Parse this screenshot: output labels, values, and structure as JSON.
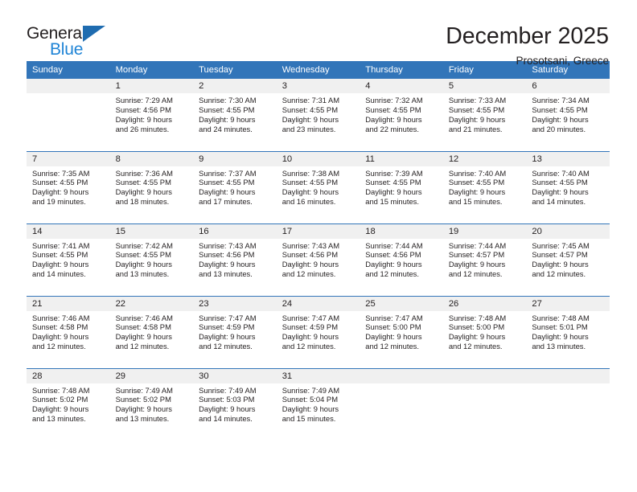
{
  "brand": {
    "name_dark": "General",
    "name_blue": "Blue",
    "accent_blue": "#1f84d6",
    "triangle_blue": "#1f6cb0"
  },
  "header": {
    "month_title": "December 2025",
    "location": "Prosotsani, Greece",
    "header_bg": "#3275b9",
    "daynum_bg": "#f0f0f0"
  },
  "weekday_headers": [
    "Sunday",
    "Monday",
    "Tuesday",
    "Wednesday",
    "Thursday",
    "Friday",
    "Saturday"
  ],
  "weeks": [
    [
      {
        "day": "",
        "sunrise": "",
        "sunset": "",
        "daylight_line1": "",
        "daylight_line2": ""
      },
      {
        "day": "1",
        "sunrise": "Sunrise: 7:29 AM",
        "sunset": "Sunset: 4:56 PM",
        "daylight_line1": "Daylight: 9 hours",
        "daylight_line2": "and 26 minutes."
      },
      {
        "day": "2",
        "sunrise": "Sunrise: 7:30 AM",
        "sunset": "Sunset: 4:55 PM",
        "daylight_line1": "Daylight: 9 hours",
        "daylight_line2": "and 24 minutes."
      },
      {
        "day": "3",
        "sunrise": "Sunrise: 7:31 AM",
        "sunset": "Sunset: 4:55 PM",
        "daylight_line1": "Daylight: 9 hours",
        "daylight_line2": "and 23 minutes."
      },
      {
        "day": "4",
        "sunrise": "Sunrise: 7:32 AM",
        "sunset": "Sunset: 4:55 PM",
        "daylight_line1": "Daylight: 9 hours",
        "daylight_line2": "and 22 minutes."
      },
      {
        "day": "5",
        "sunrise": "Sunrise: 7:33 AM",
        "sunset": "Sunset: 4:55 PM",
        "daylight_line1": "Daylight: 9 hours",
        "daylight_line2": "and 21 minutes."
      },
      {
        "day": "6",
        "sunrise": "Sunrise: 7:34 AM",
        "sunset": "Sunset: 4:55 PM",
        "daylight_line1": "Daylight: 9 hours",
        "daylight_line2": "and 20 minutes."
      }
    ],
    [
      {
        "day": "7",
        "sunrise": "Sunrise: 7:35 AM",
        "sunset": "Sunset: 4:55 PM",
        "daylight_line1": "Daylight: 9 hours",
        "daylight_line2": "and 19 minutes."
      },
      {
        "day": "8",
        "sunrise": "Sunrise: 7:36 AM",
        "sunset": "Sunset: 4:55 PM",
        "daylight_line1": "Daylight: 9 hours",
        "daylight_line2": "and 18 minutes."
      },
      {
        "day": "9",
        "sunrise": "Sunrise: 7:37 AM",
        "sunset": "Sunset: 4:55 PM",
        "daylight_line1": "Daylight: 9 hours",
        "daylight_line2": "and 17 minutes."
      },
      {
        "day": "10",
        "sunrise": "Sunrise: 7:38 AM",
        "sunset": "Sunset: 4:55 PM",
        "daylight_line1": "Daylight: 9 hours",
        "daylight_line2": "and 16 minutes."
      },
      {
        "day": "11",
        "sunrise": "Sunrise: 7:39 AM",
        "sunset": "Sunset: 4:55 PM",
        "daylight_line1": "Daylight: 9 hours",
        "daylight_line2": "and 15 minutes."
      },
      {
        "day": "12",
        "sunrise": "Sunrise: 7:40 AM",
        "sunset": "Sunset: 4:55 PM",
        "daylight_line1": "Daylight: 9 hours",
        "daylight_line2": "and 15 minutes."
      },
      {
        "day": "13",
        "sunrise": "Sunrise: 7:40 AM",
        "sunset": "Sunset: 4:55 PM",
        "daylight_line1": "Daylight: 9 hours",
        "daylight_line2": "and 14 minutes."
      }
    ],
    [
      {
        "day": "14",
        "sunrise": "Sunrise: 7:41 AM",
        "sunset": "Sunset: 4:55 PM",
        "daylight_line1": "Daylight: 9 hours",
        "daylight_line2": "and 14 minutes."
      },
      {
        "day": "15",
        "sunrise": "Sunrise: 7:42 AM",
        "sunset": "Sunset: 4:55 PM",
        "daylight_line1": "Daylight: 9 hours",
        "daylight_line2": "and 13 minutes."
      },
      {
        "day": "16",
        "sunrise": "Sunrise: 7:43 AM",
        "sunset": "Sunset: 4:56 PM",
        "daylight_line1": "Daylight: 9 hours",
        "daylight_line2": "and 13 minutes."
      },
      {
        "day": "17",
        "sunrise": "Sunrise: 7:43 AM",
        "sunset": "Sunset: 4:56 PM",
        "daylight_line1": "Daylight: 9 hours",
        "daylight_line2": "and 12 minutes."
      },
      {
        "day": "18",
        "sunrise": "Sunrise: 7:44 AM",
        "sunset": "Sunset: 4:56 PM",
        "daylight_line1": "Daylight: 9 hours",
        "daylight_line2": "and 12 minutes."
      },
      {
        "day": "19",
        "sunrise": "Sunrise: 7:44 AM",
        "sunset": "Sunset: 4:57 PM",
        "daylight_line1": "Daylight: 9 hours",
        "daylight_line2": "and 12 minutes."
      },
      {
        "day": "20",
        "sunrise": "Sunrise: 7:45 AM",
        "sunset": "Sunset: 4:57 PM",
        "daylight_line1": "Daylight: 9 hours",
        "daylight_line2": "and 12 minutes."
      }
    ],
    [
      {
        "day": "21",
        "sunrise": "Sunrise: 7:46 AM",
        "sunset": "Sunset: 4:58 PM",
        "daylight_line1": "Daylight: 9 hours",
        "daylight_line2": "and 12 minutes."
      },
      {
        "day": "22",
        "sunrise": "Sunrise: 7:46 AM",
        "sunset": "Sunset: 4:58 PM",
        "daylight_line1": "Daylight: 9 hours",
        "daylight_line2": "and 12 minutes."
      },
      {
        "day": "23",
        "sunrise": "Sunrise: 7:47 AM",
        "sunset": "Sunset: 4:59 PM",
        "daylight_line1": "Daylight: 9 hours",
        "daylight_line2": "and 12 minutes."
      },
      {
        "day": "24",
        "sunrise": "Sunrise: 7:47 AM",
        "sunset": "Sunset: 4:59 PM",
        "daylight_line1": "Daylight: 9 hours",
        "daylight_line2": "and 12 minutes."
      },
      {
        "day": "25",
        "sunrise": "Sunrise: 7:47 AM",
        "sunset": "Sunset: 5:00 PM",
        "daylight_line1": "Daylight: 9 hours",
        "daylight_line2": "and 12 minutes."
      },
      {
        "day": "26",
        "sunrise": "Sunrise: 7:48 AM",
        "sunset": "Sunset: 5:00 PM",
        "daylight_line1": "Daylight: 9 hours",
        "daylight_line2": "and 12 minutes."
      },
      {
        "day": "27",
        "sunrise": "Sunrise: 7:48 AM",
        "sunset": "Sunset: 5:01 PM",
        "daylight_line1": "Daylight: 9 hours",
        "daylight_line2": "and 13 minutes."
      }
    ],
    [
      {
        "day": "28",
        "sunrise": "Sunrise: 7:48 AM",
        "sunset": "Sunset: 5:02 PM",
        "daylight_line1": "Daylight: 9 hours",
        "daylight_line2": "and 13 minutes."
      },
      {
        "day": "29",
        "sunrise": "Sunrise: 7:49 AM",
        "sunset": "Sunset: 5:02 PM",
        "daylight_line1": "Daylight: 9 hours",
        "daylight_line2": "and 13 minutes."
      },
      {
        "day": "30",
        "sunrise": "Sunrise: 7:49 AM",
        "sunset": "Sunset: 5:03 PM",
        "daylight_line1": "Daylight: 9 hours",
        "daylight_line2": "and 14 minutes."
      },
      {
        "day": "31",
        "sunrise": "Sunrise: 7:49 AM",
        "sunset": "Sunset: 5:04 PM",
        "daylight_line1": "Daylight: 9 hours",
        "daylight_line2": "and 15 minutes."
      },
      {
        "day": "",
        "sunrise": "",
        "sunset": "",
        "daylight_line1": "",
        "daylight_line2": ""
      },
      {
        "day": "",
        "sunrise": "",
        "sunset": "",
        "daylight_line1": "",
        "daylight_line2": ""
      },
      {
        "day": "",
        "sunrise": "",
        "sunset": "",
        "daylight_line1": "",
        "daylight_line2": ""
      }
    ]
  ]
}
